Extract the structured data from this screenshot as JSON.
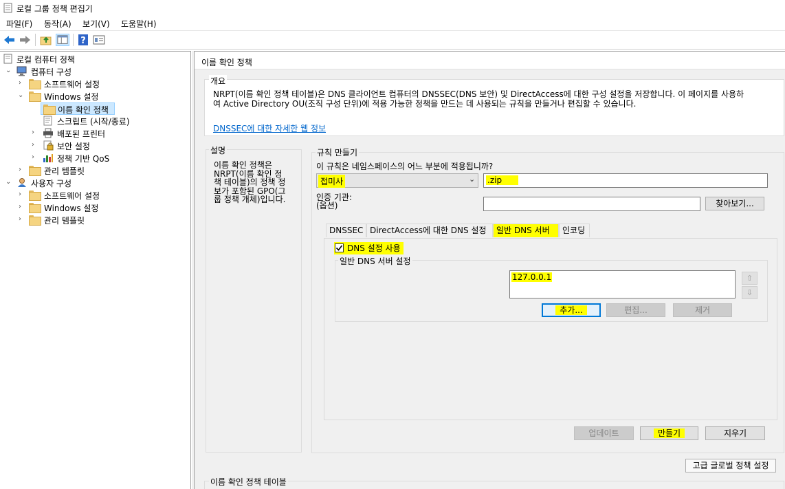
{
  "window": {
    "title": "로컬 그룹 정책 편집기"
  },
  "menu": [
    {
      "label": "파일(F)"
    },
    {
      "label": "동작(A)"
    },
    {
      "label": "보기(V)"
    },
    {
      "label": "도움말(H)"
    }
  ],
  "toolbar": {
    "icons": [
      "back-arrow-icon",
      "forward-arrow-icon",
      "up-folder-icon",
      "show-hide-tree-icon",
      "help-icon",
      "properties-icon"
    ]
  },
  "tree": {
    "root": "로컬 컴퓨터 정책",
    "computer_config": "컴퓨터 구성",
    "cc_software": "소프트웨어 설정",
    "cc_windows": "Windows 설정",
    "cc_nrpt": "이름 확인 정책",
    "cc_scripts": "스크립트 (시작/종료)",
    "cc_printers": "배포된 프린터",
    "cc_security": "보안 설정",
    "cc_qos": "정책 기반 QoS",
    "cc_admin": "관리 템플릿",
    "user_config": "사용자 구성",
    "uc_software": "소프트웨어 설정",
    "uc_windows": "Windows 설정",
    "uc_admin": "관리 템플릿"
  },
  "main": {
    "header": "이름 확인 정책",
    "overview": {
      "title": "개요",
      "line1": "NRPT(이름 확인 정책 테이블)은 DNS 클라이언트 컴퓨터의 DNSSEC(DNS 보안) 및 DirectAccess에 대한 구성 설정을 저장합니다. 이 페이지를 사용하",
      "line2": "여 Active Directory OU(조직 구성 단위)에 적용 가능한 정책을 만드는 데 사용되는 규칙을 만들거나 편집할 수 있습니다.",
      "link": "DNSSEC에 대한 자세한 웹 정보"
    },
    "description": {
      "title": "설명",
      "line1": "이름 확인 정책은",
      "line2": "NRPT(이름 확인 정",
      "line3": "책 테이블)의 정책 정",
      "line4": "보가 포함된 GPO(그",
      "line5": "룹 정책 개체)입니다."
    },
    "rules": {
      "title": "규칙 만들기",
      "question": "이 규칙은 네임스페이스의 어느 부분에 적용됩니까?",
      "namespace_type": "접미사",
      "namespace_value": ".zip",
      "ca_label_1": "인증 기관:",
      "ca_label_2": "(옵션)",
      "ca_value": "",
      "browse": "찾아보기...",
      "tabs": [
        "DNSSEC",
        "DirectAccess에 대한 DNS 설정",
        "일반 DNS 서버",
        "인코딩"
      ],
      "use_dns_label": "DNS 설정 사용",
      "use_dns_checked": true,
      "dns_group_title": "일반 DNS 서버 설정",
      "dns_servers": [
        "127.0.0.1"
      ],
      "add": "추가...",
      "edit": "편집...",
      "remove": "제거",
      "update": "업데이트",
      "create": "만들기",
      "clear": "지우기"
    },
    "advanced_button": "고급 글로벌 정책 설정",
    "table_title": "이름 확인 정책 테이블"
  }
}
